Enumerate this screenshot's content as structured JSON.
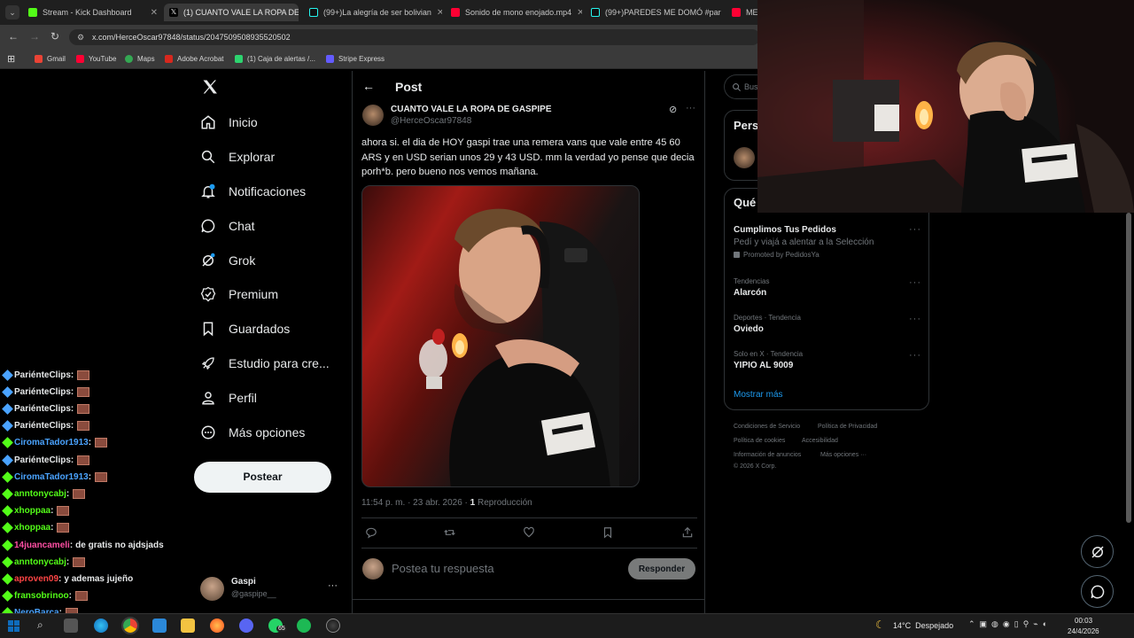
{
  "browser": {
    "tabs": [
      {
        "label": "Stream - Kick Dashboard",
        "color": "#53fc18"
      },
      {
        "label": "(1) CUANTO VALE LA ROPA DE",
        "color": "#ffffff"
      },
      {
        "label": "(99+)La alegría de ser bolivian",
        "color": "#ffffff"
      },
      {
        "label": "Sonido de mono enojado.mp4",
        "color": "#ff0033"
      },
      {
        "label": "(99+)PAREDES ME DOMÓ #par",
        "color": "#ffffff"
      },
      {
        "label": "ME T",
        "color": "#ff0033"
      }
    ],
    "url": "x.com/HerceOscar97848/status/2047509508935520502",
    "bookmarks": [
      {
        "label": "Gmail",
        "color": "#ea4335"
      },
      {
        "label": "YouTube",
        "color": "#ff0033"
      },
      {
        "label": "Maps",
        "color": "#34a853"
      },
      {
        "label": "Adobe Acrobat",
        "color": "#d7281e"
      },
      {
        "label": "(1) Caja de alertas /...",
        "color": "#2dd36f"
      },
      {
        "label": "Stripe Express",
        "color": "#635bff"
      }
    ]
  },
  "nav": {
    "items": [
      {
        "label": "Inicio",
        "icon": "home-icon"
      },
      {
        "label": "Explorar",
        "icon": "search-icon"
      },
      {
        "label": "Notificaciones",
        "icon": "bell-icon"
      },
      {
        "label": "Chat",
        "icon": "chat-icon"
      },
      {
        "label": "Grok",
        "icon": "grok-icon"
      },
      {
        "label": "Premium",
        "icon": "premium-icon"
      },
      {
        "label": "Guardados",
        "icon": "bookmark-icon"
      },
      {
        "label": "Estudio para cre...",
        "icon": "rocket-icon"
      },
      {
        "label": "Perfil",
        "icon": "person-icon"
      },
      {
        "label": "Más opciones",
        "icon": "more-circle-icon"
      }
    ],
    "post_button": "Postear",
    "account": {
      "name": "Gaspi",
      "handle": "@gaspipe__"
    }
  },
  "post": {
    "header": "Post",
    "author_name": "CUANTO VALE LA ROPA DE GASPIPE",
    "author_handle": "@HerceOscar97848",
    "text": "ahora si. el dia de HOY gaspi trae una remera vans que vale entre 45  60 ARS y en USD serian unos 29 y 43 USD. mm la verdad yo pense que decia porh*b. pero bueno nos vemos mañana.",
    "timestamp": "11:54 p. m. · 23 abr. 2026 · ",
    "views_count": "1",
    "views_label": " Reproducción",
    "reply_placeholder": "Postea tu respuesta",
    "reply_button": "Responder"
  },
  "sidebar": {
    "search_placeholder": "Bus",
    "box1_title": "Pers",
    "box2_title": "Qué",
    "promo": {
      "title": "Cumplimos Tus Pedidos",
      "subtitle": "Pedí y viajá a alentar a la Selección",
      "promoted": "Promoted by PedidosYa"
    },
    "trends": [
      {
        "context": "Tendencias",
        "name": "Alarcón"
      },
      {
        "context": "Deportes · Tendencia",
        "name": "Oviedo"
      },
      {
        "context": "Solo en X · Tendencia",
        "name": "YIPIO AL 9009"
      }
    ],
    "show_more": "Mostrar más",
    "footer": [
      "Condiciones de Servicio",
      "Política de Privacidad",
      "Política de cookies",
      "Accesibilidad",
      "Información de anuncios",
      "Más opciones ···",
      "© 2026 X Corp."
    ]
  },
  "chat": [
    {
      "user": "PariénteClips",
      "color": "#e7e9ea",
      "msg": ""
    },
    {
      "user": "PariénteClips",
      "color": "#e7e9ea",
      "msg": ""
    },
    {
      "user": "PariénteClips",
      "color": "#e7e9ea",
      "msg": ""
    },
    {
      "user": "PariénteClips",
      "color": "#e7e9ea",
      "msg": ""
    },
    {
      "user": "CiromaTador1913",
      "color": "#4aa3ff",
      "msg": ""
    },
    {
      "user": "PariénteClips",
      "color": "#e7e9ea",
      "msg": ""
    },
    {
      "user": "CiromaTador1913",
      "color": "#4aa3ff",
      "msg": ""
    },
    {
      "user": "anntonycabj",
      "color": "#53fc18",
      "msg": ""
    },
    {
      "user": "xhoppaa",
      "color": "#53fc18",
      "msg": ""
    },
    {
      "user": "xhoppaa",
      "color": "#53fc18",
      "msg": ""
    },
    {
      "user": "14juancameli",
      "color": "#ff4fa3",
      "msg": "de gratis no ajdsjads"
    },
    {
      "user": "anntonycabj",
      "color": "#53fc18",
      "msg": ""
    },
    {
      "user": "aproven09",
      "color": "#ff4545",
      "msg": "y ademas jujeño"
    },
    {
      "user": "fransobrinoo",
      "color": "#53fc18",
      "msg": ""
    },
    {
      "user": "NeroBarca",
      "color": "#4aa3ff",
      "msg": ""
    }
  ],
  "taskbar": {
    "weather": "14°C  Despejado",
    "time": "00:03",
    "date": "24/4/2026",
    "whatsapp_badge": "65"
  },
  "colors": {
    "accent": "#1d9bf0",
    "bg": "#000000",
    "border": "#2f3336"
  }
}
